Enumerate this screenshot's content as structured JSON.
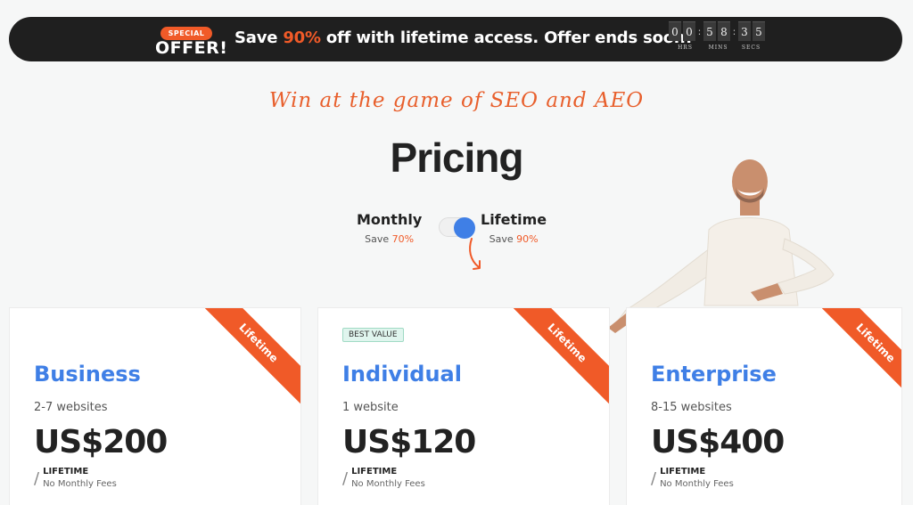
{
  "banner": {
    "badge_small": "SPECIAL",
    "badge_big": "OFFER!",
    "message_before": "Save ",
    "message_highlight": "90%",
    "message_after": " off with lifetime access. Offer ends soon!",
    "timer": {
      "h1": "0",
      "h2": "0",
      "m1": "5",
      "m2": "8",
      "s1": "3",
      "s2": "5"
    },
    "timer_labels": {
      "hrs": "HRS",
      "mins": "MINS",
      "secs": "SECS"
    }
  },
  "tagline": "Win at the game of SEO and AEO",
  "title": "Pricing",
  "billing": {
    "monthly": {
      "label": "Monthly",
      "save_text": "Save ",
      "save_pct": "70%"
    },
    "lifetime": {
      "label": "Lifetime",
      "save_text": "Save ",
      "save_pct": "90%"
    },
    "selected": "Lifetime"
  },
  "plans": [
    {
      "name": "Business",
      "sites": "2-7 websites",
      "price": "US$200",
      "period": "LIFETIME",
      "period_note": "No Monthly Fees",
      "ribbon": "Lifetime",
      "badge": ""
    },
    {
      "name": "Individual",
      "sites": "1 website",
      "price": "US$120",
      "period": "LIFETIME",
      "period_note": "No Monthly Fees",
      "ribbon": "Lifetime",
      "badge": "BEST VALUE"
    },
    {
      "name": "Enterprise",
      "sites": "8-15 websites",
      "price": "US$400",
      "period": "LIFETIME",
      "period_note": "No Monthly Fees",
      "ribbon": "Lifetime",
      "badge": ""
    }
  ],
  "colors": {
    "accent": "#f05a28",
    "primary": "#3f7fe6",
    "banner_bg": "#1f1f1f"
  }
}
